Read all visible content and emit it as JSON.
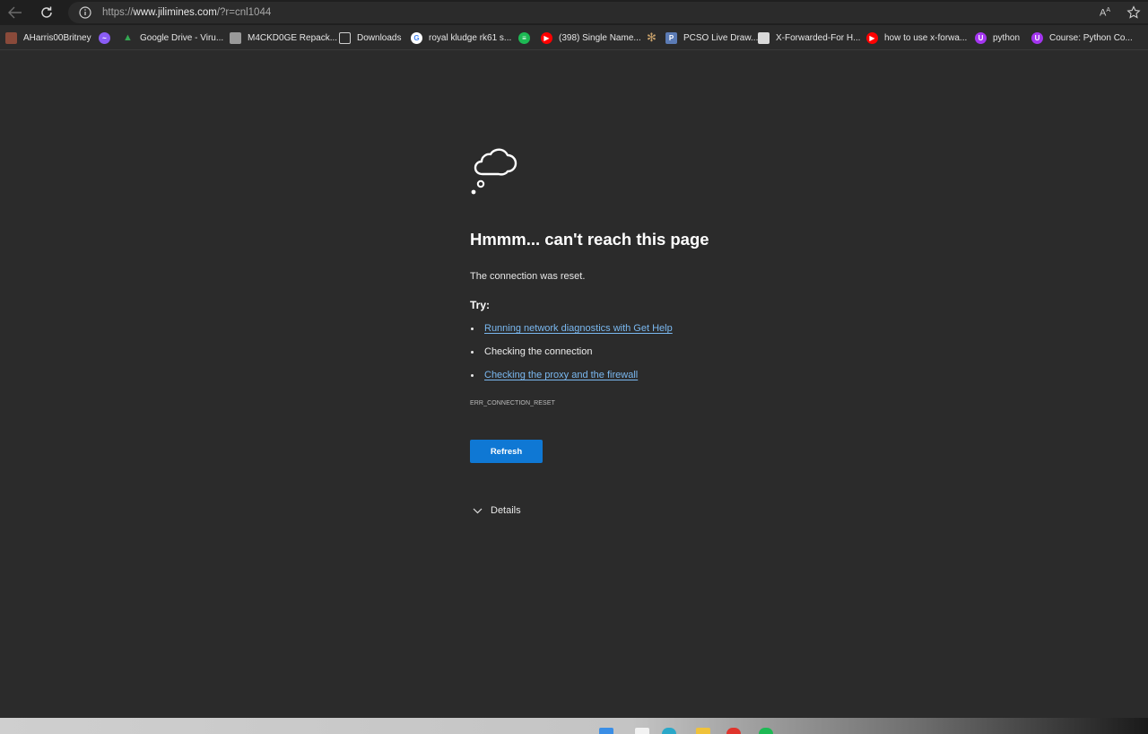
{
  "address_bar": {
    "url_scheme": "https://",
    "url_host": "www.jilimines.com",
    "url_path": "/?r=cnl1044",
    "read_aloud_label": "A"
  },
  "favorites": [
    {
      "label": "AHarris00Britney",
      "icon": "person-photo-icon",
      "color": "#8a4a3a"
    },
    {
      "label": "",
      "icon": "messenger-icon",
      "color": "#8a5cf6"
    },
    {
      "label": "Google Drive - Viru...",
      "icon": "google-drive-icon",
      "color": "#34a853"
    },
    {
      "label": "M4CKD0GE Repack...",
      "icon": "site-icon",
      "color": "#9a9a9a"
    },
    {
      "label": "Downloads",
      "icon": "document-icon",
      "color": "#cfcfcf"
    },
    {
      "label": "royal kludge rk61 s...",
      "icon": "google-icon",
      "color": "#ffffff"
    },
    {
      "label": "",
      "icon": "spotify-icon",
      "color": "#1db954"
    },
    {
      "label": "(398) Single Name...",
      "icon": "youtube-icon",
      "color": "#ff0000"
    },
    {
      "label": "",
      "icon": "pattern-icon",
      "color": "#c9a26b"
    },
    {
      "label": "PCSO Live Draw...",
      "icon": "pcso-icon",
      "color": "#5b7bb5"
    },
    {
      "label": "X-Forwarded-For H...",
      "icon": "image-icon",
      "color": "#d9d9d9"
    },
    {
      "label": "how to use x-forwa...",
      "icon": "youtube-icon",
      "color": "#ff0000"
    },
    {
      "label": "python",
      "icon": "udemy-icon",
      "color": "#a435f0"
    },
    {
      "label": "Course: Python Co...",
      "icon": "udemy-icon",
      "color": "#a435f0"
    }
  ],
  "error_page": {
    "title": "Hmmm... can't reach this page",
    "description": "The connection was reset.",
    "try_label": "Try:",
    "suggestions": [
      {
        "text": "Running network diagnostics with Get Help",
        "is_link": true
      },
      {
        "text": "Checking the connection",
        "is_link": false
      },
      {
        "text": "Checking the proxy and the firewall",
        "is_link": true
      }
    ],
    "error_code": "ERR_CONNECTION_RESET",
    "refresh_label": "Refresh",
    "details_label": "Details"
  },
  "colors": {
    "background": "#2b2b2b",
    "link": "#7ab8f0",
    "primary_button": "#0f78d4"
  }
}
